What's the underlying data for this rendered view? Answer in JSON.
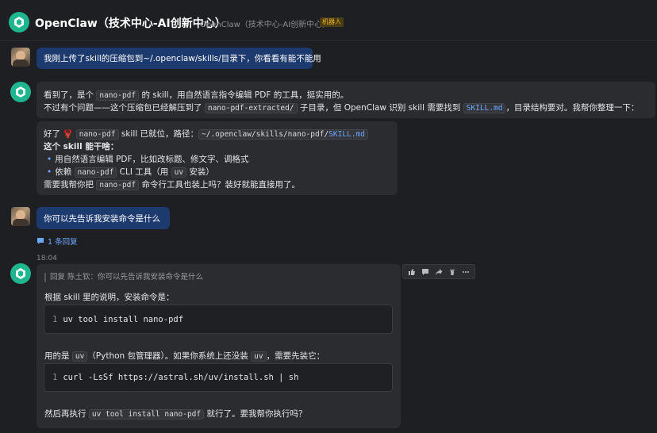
{
  "header": {
    "title": "OpenClaw（技术中心-AI创新中心）",
    "subtitle": "OpenClaw（技术中心-AI创新中心）",
    "badge": "机器人"
  },
  "messages": {
    "m1": {
      "text": "我刚上传了skill的压缩包到~/.openclaw/skills/目录下，你看看有能不能用"
    },
    "m2": {
      "l1_a": "看到了，是个 ",
      "l1_code": "nano-pdf",
      "l1_b": " 的 skill，用自然语言指令编辑 PDF 的工具，挺实用的。",
      "l2_a": "不过有个问题——这个压缩包已经解压到了 ",
      "l2_code": "nano-pdf-extracted/",
      "l2_b": " 子目录，但 OpenClaw 识别 skill 需要找到 ",
      "l2_code2": "SKILL.md",
      "l2_c": "，目录结构要对。我帮你整理一下："
    },
    "m3": {
      "l1_a": "好了 ",
      "l1_emoji": "🦞",
      "l1_code": "nano-pdf",
      "l1_b": " skill 已就位，路径：",
      "l1_path": "~/.openclaw/skills/nano-pdf/",
      "l1_link": "SKILL.md",
      "l2": "这个 skill 能干啥：",
      "b1": "用自然语言编辑 PDF，比如改标题、修文字、调格式",
      "b2_a": "依赖 ",
      "b2_code": "nano-pdf",
      "b2_b": " CLI 工具（用 ",
      "b2_code2": "uv",
      "b2_c": " 安装）",
      "l5_a": "需要我帮你把 ",
      "l5_code": "nano-pdf",
      "l5_b": " 命令行工具也装上吗？装好就能直接用了。"
    },
    "m4": {
      "text": "你可以先告诉我安装命令是什么"
    },
    "reply_count": "1 条回复",
    "timestamp": "18:04",
    "m5": {
      "quote": "回复 陈土钦：你可以先告诉我安装命令是什么",
      "l1": "根据 skill 里的说明，安装命令是：",
      "code1_ln": "1",
      "code1": "uv tool install nano-pdf",
      "l2_a": "用的是 ",
      "l2_code": "uv",
      "l2_b": "（Python 包管理器）。如果你系统上还没装 ",
      "l2_code2": "uv",
      "l2_c": "，需要先装它：",
      "code2_ln": "1",
      "code2": "curl -LsSf https://astral.sh/uv/install.sh | sh",
      "l3_a": "然后再执行 ",
      "l3_code": "uv tool install nano-pdf",
      "l3_b": " 就行了。要我帮你执行吗？"
    }
  },
  "icons": [
    "bot-logo-icon",
    "thumbs-up-icon",
    "comment-icon",
    "share-icon",
    "delete-icon",
    "more-icon"
  ]
}
